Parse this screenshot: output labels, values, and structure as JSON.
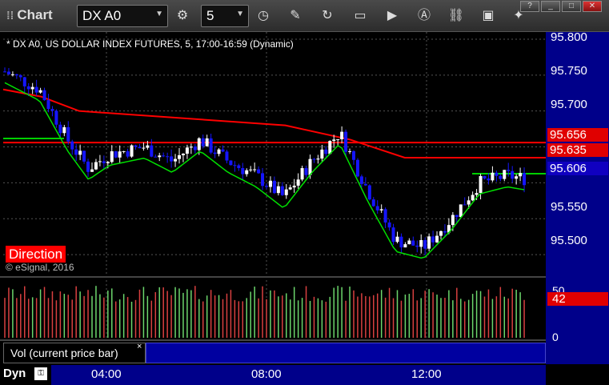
{
  "toolbar": {
    "title": "Chart",
    "symbol": "DX A0",
    "interval": "5"
  },
  "chart_info": "* DX A0, US DOLLAR INDEX FUTURES, 5, 17:00-16:59 (Dynamic)",
  "direction_label": "Direction",
  "copyright": "© eSignal, 2016",
  "volume_study_label": "Vol (current price bar)",
  "volume_close": "×",
  "dyn_label": "Dyn",
  "colors": {
    "up_candle": "#ffffff",
    "down_candle": "#1515ff",
    "resistance": "#ff0000",
    "trend_line": "#00e000",
    "axis_bg": "#00008a"
  },
  "chart_data": {
    "type": "candlestick",
    "title": "* DX A0, US DOLLAR INDEX FUTURES, 5, 17:00-16:59 (Dynamic)",
    "x_ticks": [
      "04:00",
      "08:00",
      "12:00"
    ],
    "y_ticks": [
      "95.800",
      "95.750",
      "95.700",
      "95.650",
      "95.600",
      "95.550",
      "95.500"
    ],
    "ylim": [
      95.47,
      95.81
    ],
    "price_markers": [
      {
        "label": "95.656",
        "value": 95.656,
        "color": "red"
      },
      {
        "label": "95.635",
        "value": 95.635,
        "color": "red"
      },
      {
        "label": "95.606",
        "value": 95.606,
        "color": "blue"
      }
    ],
    "red_step_line": [
      {
        "x": 0,
        "y": 95.73
      },
      {
        "x": 0.07,
        "y": 95.72
      },
      {
        "x": 0.14,
        "y": 95.7
      },
      {
        "x": 0.52,
        "y": 95.68
      },
      {
        "x": 0.64,
        "y": 95.66
      },
      {
        "x": 0.74,
        "y": 95.635
      },
      {
        "x": 1.0,
        "y": 95.635
      }
    ],
    "red_resistance_line": 95.656,
    "green_support_line": 95.606,
    "volume": {
      "max_tick": "50",
      "min_tick": "0",
      "current": "42"
    }
  }
}
